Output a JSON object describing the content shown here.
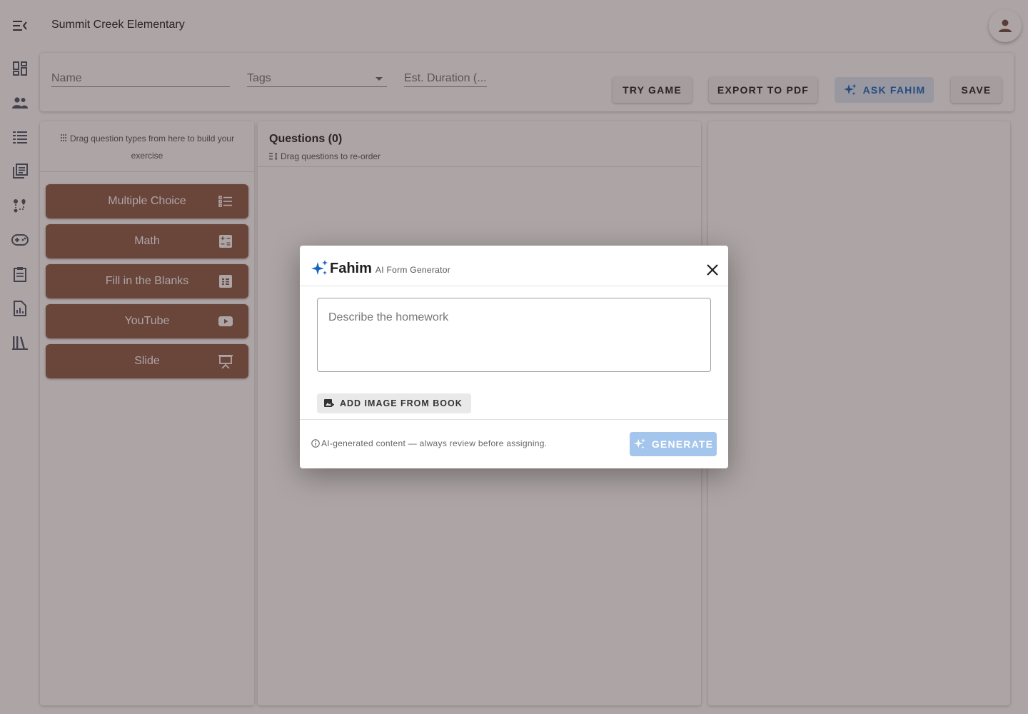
{
  "app": {
    "title": "Summit Creek Elementary"
  },
  "icons": {
    "menu": "menu-collapse-icon",
    "avatar": "person-icon",
    "rail": [
      "dashboard-icon",
      "people-icon",
      "list-icon",
      "library-books-icon",
      "route-icon",
      "gamepad-icon",
      "clipboard-icon",
      "report-icon",
      "books-icon"
    ]
  },
  "form": {
    "name_placeholder": "Name",
    "tags_placeholder": "Tags",
    "duration_placeholder": "Est. Duration (...",
    "buttons": {
      "try_game": "TRY GAME",
      "export_pdf": "EXPORT TO PDF",
      "ask_fahim": "ASK FAHIM",
      "save": "SAVE"
    }
  },
  "palette": {
    "hint": "Drag question types from here to build your exercise",
    "items": [
      {
        "label": "Multiple Choice",
        "icon": "list-icon"
      },
      {
        "label": "Math",
        "icon": "calculator-icon"
      },
      {
        "label": "Fill in the Blanks",
        "icon": "grid-icon"
      },
      {
        "label": "YouTube",
        "icon": "youtube-icon"
      },
      {
        "label": "Slide",
        "icon": "presentation-icon"
      }
    ]
  },
  "questions": {
    "title": "Questions (0)",
    "hint": "Drag questions to re-order"
  },
  "dialog": {
    "brand": "Fahim",
    "subtitle": "AI Form Generator",
    "textarea_placeholder": "Describe the homework",
    "add_image": "ADD IMAGE FROM BOOK",
    "note": "AI-generated content — always review before assigning.",
    "generate": "GENERATE"
  },
  "colors": {
    "accent": "#1565c0",
    "palette_item": "#8a5a48",
    "generate_button": "#a4c6ec",
    "ask_button_bg": "#dde8f6"
  }
}
